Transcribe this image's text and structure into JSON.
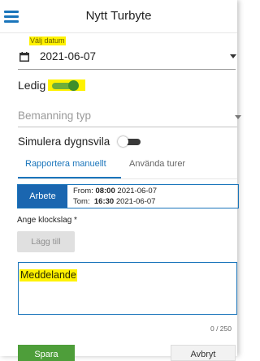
{
  "header": {
    "title": "Nytt Turbyte",
    "menu_icon": "hamburger-menu-icon"
  },
  "date_field": {
    "label": "Välj datum",
    "value": "2021-06-07",
    "icon": "calendar-icon"
  },
  "ledig": {
    "label": "Ledig",
    "on": true
  },
  "bemanning": {
    "placeholder": "Bemanning typ"
  },
  "simulera": {
    "label": "Simulera dygnsvila",
    "on": false
  },
  "tabs": [
    {
      "label": "Rapportera manuellt",
      "active": true
    },
    {
      "label": "Använda turer",
      "active": false
    }
  ],
  "shift": {
    "badge": "Arbete",
    "from_label": "From:",
    "from_time": "08:00",
    "from_date": "2021-06-07",
    "to_label": "Tom:",
    "to_time": "16:30",
    "to_date": "2021-06-07"
  },
  "klockslag": {
    "label": "Ange klockslag *",
    "add_button": "Lägg till"
  },
  "message": {
    "placeholder": "Meddelande",
    "counter": "0 / 250"
  },
  "actions": {
    "save": "Spara",
    "cancel": "Avbryt"
  },
  "colors": {
    "accent": "#1a75bb",
    "highlight": "#fff200",
    "save": "#4e9e3a",
    "toggle_on": "#3d8e2a"
  }
}
